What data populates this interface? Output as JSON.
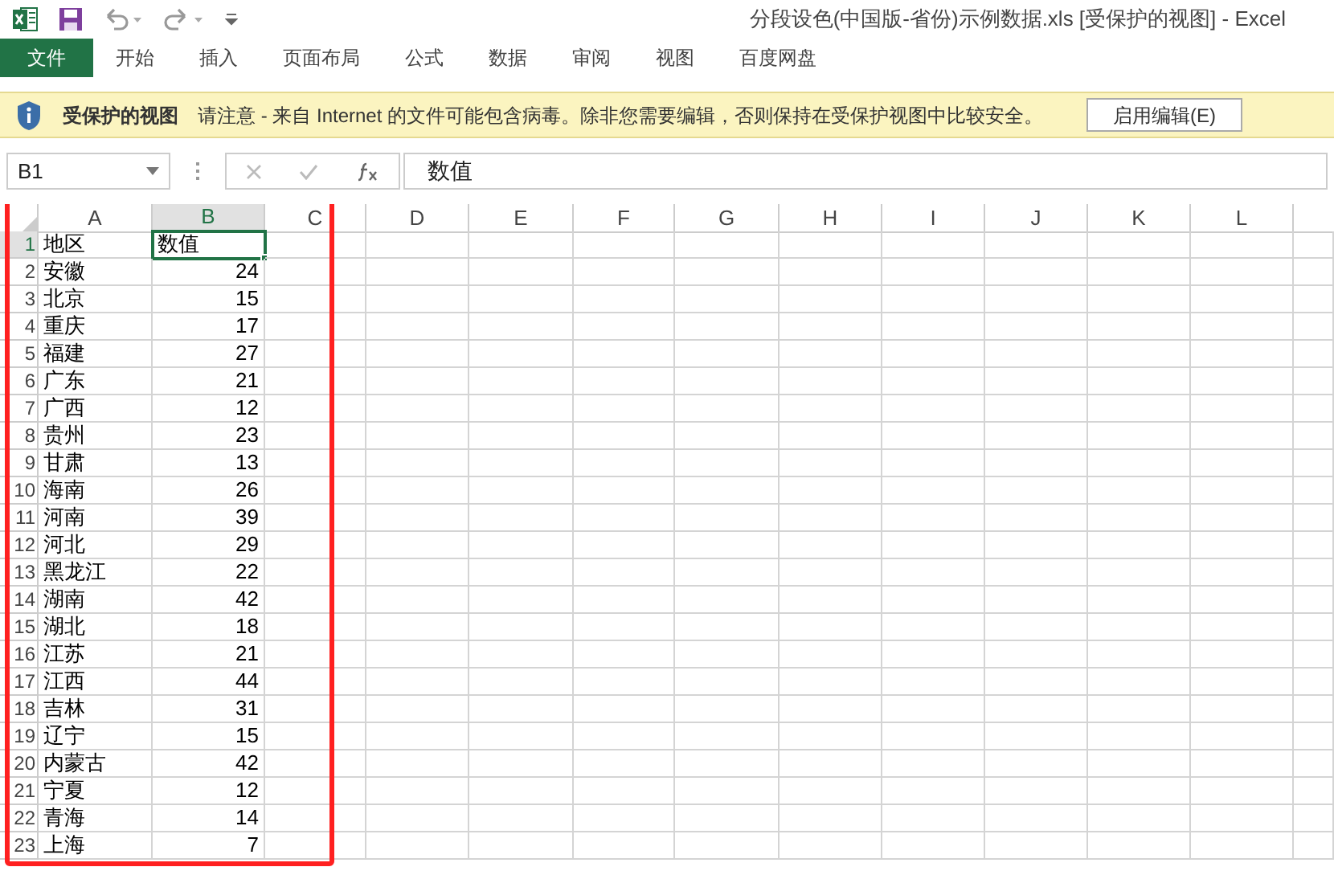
{
  "title_bar": {
    "title": "分段设色(中国版-省份)示例数据.xls  [受保护的视图] - Excel"
  },
  "ribbon": {
    "tabs": [
      {
        "label": "文件",
        "kind": "file",
        "selected": false
      },
      {
        "label": "开始",
        "kind": "tab",
        "selected": false
      },
      {
        "label": "插入",
        "kind": "tab",
        "selected": false
      },
      {
        "label": "页面布局",
        "kind": "tab",
        "selected": false
      },
      {
        "label": "公式",
        "kind": "tab",
        "selected": false
      },
      {
        "label": "数据",
        "kind": "tab",
        "selected": false
      },
      {
        "label": "审阅",
        "kind": "tab",
        "selected": false
      },
      {
        "label": "视图",
        "kind": "tab",
        "selected": false
      },
      {
        "label": "百度网盘",
        "kind": "tab",
        "selected": false
      }
    ]
  },
  "protected_view": {
    "title": "受保护的视图",
    "message": "请注意 - 来自 Internet 的文件可能包含病毒。除非您需要编辑，否则保持在受保护视图中比较安全。",
    "button": "启用编辑(E)"
  },
  "formula_bar": {
    "name_box": "B1",
    "formula": "数值"
  },
  "sheet": {
    "columns": [
      {
        "label": "A",
        "selected": false
      },
      {
        "label": "B",
        "selected": true
      },
      {
        "label": "C",
        "selected": false
      },
      {
        "label": "D",
        "selected": false
      },
      {
        "label": "E",
        "selected": false
      },
      {
        "label": "F",
        "selected": false
      },
      {
        "label": "G",
        "selected": false
      },
      {
        "label": "H",
        "selected": false
      },
      {
        "label": "I",
        "selected": false
      },
      {
        "label": "J",
        "selected": false
      },
      {
        "label": "K",
        "selected": false
      },
      {
        "label": "L",
        "selected": false
      }
    ],
    "rows": [
      {
        "number": "1",
        "selected": true,
        "region": "地区",
        "value": "数值"
      },
      {
        "number": "2",
        "selected": false,
        "region": "安徽",
        "value": "24"
      },
      {
        "number": "3",
        "selected": false,
        "region": "北京",
        "value": "15"
      },
      {
        "number": "4",
        "selected": false,
        "region": "重庆",
        "value": "17"
      },
      {
        "number": "5",
        "selected": false,
        "region": "福建",
        "value": "27"
      },
      {
        "number": "6",
        "selected": false,
        "region": "广东",
        "value": "21"
      },
      {
        "number": "7",
        "selected": false,
        "region": "广西",
        "value": "12"
      },
      {
        "number": "8",
        "selected": false,
        "region": "贵州",
        "value": "23"
      },
      {
        "number": "9",
        "selected": false,
        "region": "甘肃",
        "value": "13"
      },
      {
        "number": "10",
        "selected": false,
        "region": "海南",
        "value": "26"
      },
      {
        "number": "11",
        "selected": false,
        "region": "河南",
        "value": "39"
      },
      {
        "number": "12",
        "selected": false,
        "region": "河北",
        "value": "29"
      },
      {
        "number": "13",
        "selected": false,
        "region": "黑龙江",
        "value": "22"
      },
      {
        "number": "14",
        "selected": false,
        "region": "湖南",
        "value": "42"
      },
      {
        "number": "15",
        "selected": false,
        "region": "湖北",
        "value": "18"
      },
      {
        "number": "16",
        "selected": false,
        "region": "江苏",
        "value": "21"
      },
      {
        "number": "17",
        "selected": false,
        "region": "江西",
        "value": "44"
      },
      {
        "number": "18",
        "selected": false,
        "region": "吉林",
        "value": "31"
      },
      {
        "number": "19",
        "selected": false,
        "region": "辽宁",
        "value": "15"
      },
      {
        "number": "20",
        "selected": false,
        "region": "内蒙古",
        "value": "42"
      },
      {
        "number": "21",
        "selected": false,
        "region": "宁夏",
        "value": "12"
      },
      {
        "number": "22",
        "selected": false,
        "region": "青海",
        "value": "14"
      },
      {
        "number": "23",
        "selected": false,
        "region": "上海",
        "value": "7"
      }
    ]
  }
}
